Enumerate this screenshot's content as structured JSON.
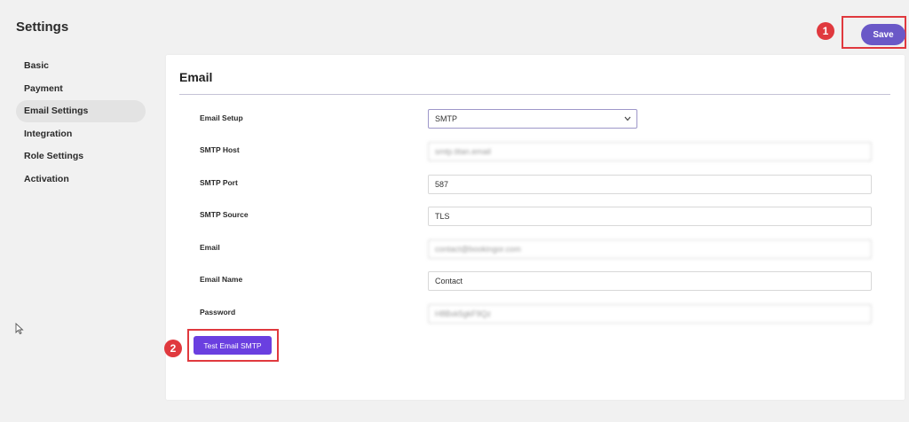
{
  "page_title": "Settings",
  "sidebar": {
    "items": [
      {
        "label": "Basic"
      },
      {
        "label": "Payment"
      },
      {
        "label": "Email Settings",
        "active": true
      },
      {
        "label": "Integration"
      },
      {
        "label": "Role Settings"
      },
      {
        "label": "Activation"
      }
    ]
  },
  "header": {
    "save_label": "Save",
    "badge": "1"
  },
  "email": {
    "title": "Email",
    "setup_label": "Email Setup",
    "setup_value": "SMTP",
    "fields": [
      {
        "label": "SMTP Host",
        "value": "smtp.titan.email",
        "blurred": true
      },
      {
        "label": "SMTP Port",
        "value": "587"
      },
      {
        "label": "SMTP Source",
        "value": "TLS"
      },
      {
        "label": "Email",
        "value": "contact@bookingor.com",
        "blurred": true
      },
      {
        "label": "Email Name",
        "value": "Contact"
      },
      {
        "label": "Password",
        "value": "H8Bxk5gkF9Qz",
        "blurred": true
      }
    ],
    "test_button_label": "Test Email SMTP",
    "test_badge": "2"
  },
  "colors": {
    "accent": "#6a58c7",
    "test_button": "#6a3fe0",
    "highlight": "#e0393e",
    "background": "#f1f1f1"
  }
}
